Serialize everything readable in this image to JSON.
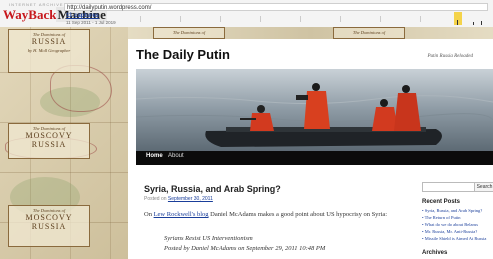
{
  "wayback": {
    "logo_small": "INTERNET ARCHIVE",
    "logo_way": "WayBack",
    "logo_machine": "Machine",
    "url": "http://dailyputin.wordpress.com/",
    "captures": "11 captures",
    "date_range": "11 Sep 2011 - 1 Jul 2019"
  },
  "map": {
    "cartouche_top_small": "The Dominions of",
    "cartouche_top_big": "RUSSIA",
    "cartouche_top_author": "by H. Moll Geographer",
    "cartouche_mid_small": "The Dominions of",
    "cartouche_mid_big": "MOSCOVY",
    "cartouche_mid_big2": "RUSSIA",
    "cartouche_bottom_small": "The Dominions of",
    "cartouche_bottom_big": "MOSCOVY",
    "cartouche_bottom_big2": "RUSSIA",
    "strip_label": "The Dominions of"
  },
  "site": {
    "title": "The Daily Putin",
    "tagline": "Putin Russia Reloaded"
  },
  "nav": {
    "home": "Home",
    "about": "About"
  },
  "post": {
    "title": "Syria, Russia, and Arab Spring?",
    "posted_prefix": "Posted on",
    "posted_date": "September 30, 2011",
    "para_prefix": "On",
    "para_link": "Lew Rockwell's blog",
    "para_rest": " Daniel McAdams makes a good point about US hypocrisy on Syria:",
    "quote_line1": "Syrians Resist US Interventionism",
    "quote_line2": "Posted by Daniel McAdams on September 29, 2011 10:48 PM"
  },
  "sidebar": {
    "search_button": "Search",
    "recent_title": "Recent Posts",
    "recent_posts": [
      "Syria, Russia, and Arab Spring?",
      "The Return of Putin",
      "What do we do about Belarus",
      "Mr. Russia, Mr. Anti-Russia?",
      "Missile Shield is Aimed At Russia"
    ],
    "archives_title": "Archives"
  }
}
